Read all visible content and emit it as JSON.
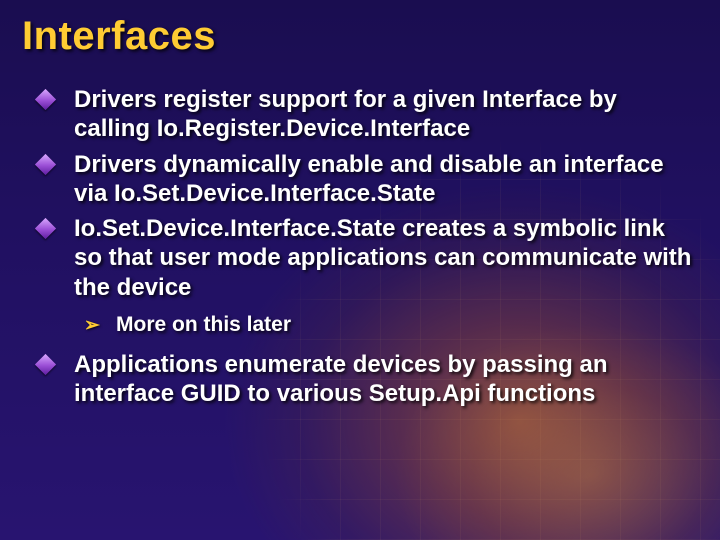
{
  "title": "Interfaces",
  "bullets": [
    {
      "text": "Drivers register support for a given Interface by calling Io.Register.Device.Interface"
    },
    {
      "text": "Drivers dynamically enable and disable an interface via Io.Set.Device.Interface.State"
    },
    {
      "text": "Io.Set.Device.Interface.State creates a symbolic link so that user mode applications can communicate with the device",
      "sub": [
        {
          "text": "More on this later"
        }
      ]
    },
    {
      "text": "Applications enumerate devices by passing an interface GUID to various Setup.Api functions"
    }
  ],
  "colors": {
    "title": "#ffcc33",
    "body_text": "#ffffff",
    "bullet_diamond": "#9b4fd6",
    "sub_chevron": "#ffcc33",
    "background_base": "#201060"
  }
}
